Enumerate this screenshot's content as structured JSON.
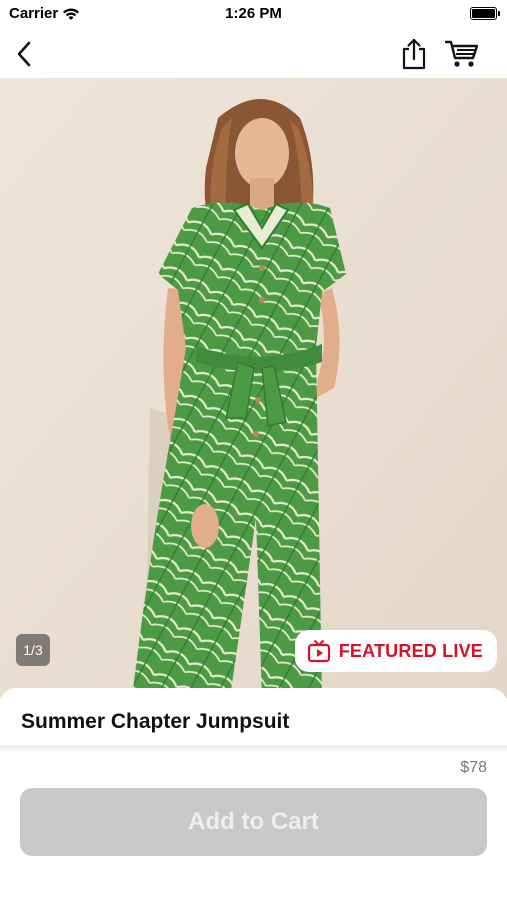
{
  "status_bar": {
    "carrier": "Carrier",
    "time": "1:26 PM"
  },
  "nav": {
    "back_icon": "chevron-left-icon",
    "share_icon": "share-icon",
    "cart_icon": "cart-icon"
  },
  "gallery": {
    "page_indicator": "1/3",
    "current_page": 1,
    "total_pages": 3
  },
  "badge": {
    "icon": "live-tv-icon",
    "label": "FEATURED LIVE",
    "color": "#d6122a"
  },
  "product": {
    "title": "Summer Chapter Jumpsuit",
    "price": "$78",
    "add_to_cart_label": "Add to Cart"
  }
}
